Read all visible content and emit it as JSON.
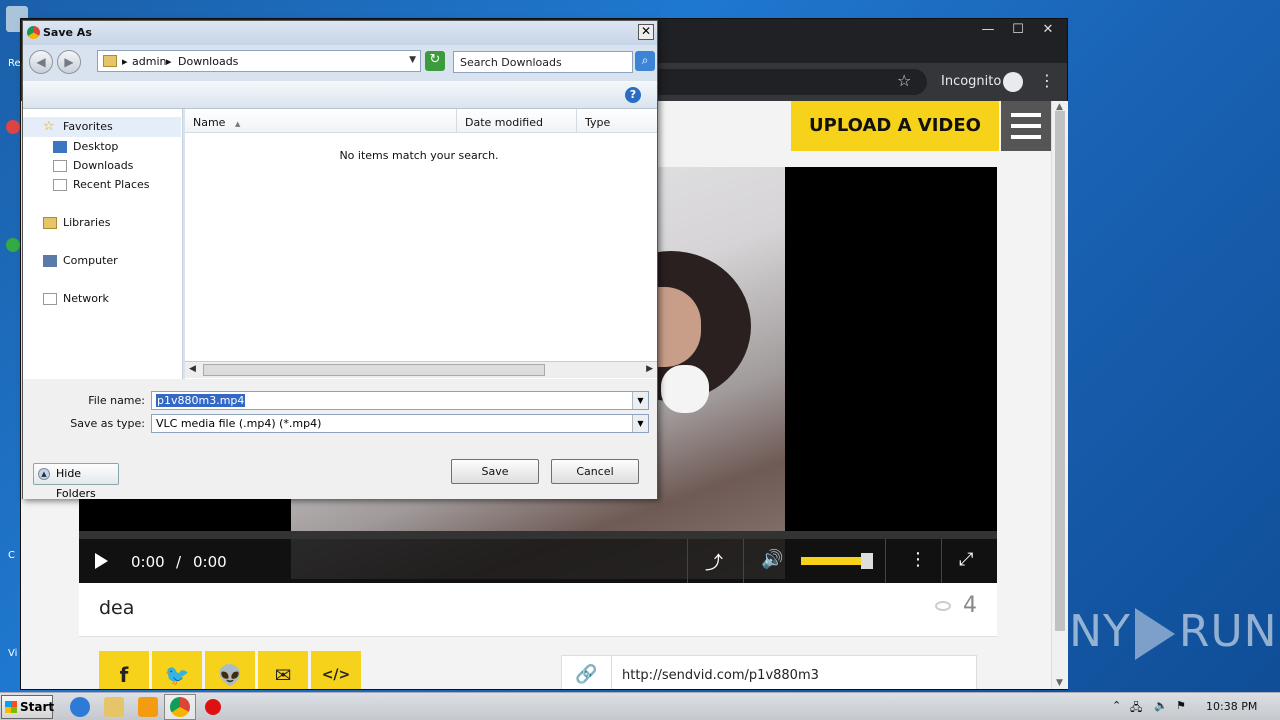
{
  "desktop": {
    "labels": [
      "Re",
      "C",
      "C",
      "Vi"
    ]
  },
  "watermark": {
    "left_text": "ANY",
    "right_text": "RUN"
  },
  "browser": {
    "window_buttons": [
      "—",
      "☐",
      "✕"
    ],
    "incognito_label": "Incognito",
    "star_icon": "☆",
    "menu_icon": "⋮",
    "page": {
      "upload_label": "UPLOAD A VIDEO",
      "player": {
        "current_time": "0:00",
        "separator": "/",
        "duration": "0:00",
        "volume_fraction": 0.85
      },
      "video_title": "dea",
      "view_count": "4",
      "share_buttons": [
        {
          "icon": "facebook-icon",
          "glyph": "f"
        },
        {
          "icon": "twitter-icon",
          "glyph": "🐦"
        },
        {
          "icon": "reddit-icon",
          "glyph": "👽"
        },
        {
          "icon": "email-icon",
          "glyph": "✉"
        },
        {
          "icon": "embed-icon",
          "glyph": "</>"
        }
      ],
      "share_link": "http://sendvid.com/p1v880m3"
    },
    "colors": {
      "accent": "#f7d21b"
    }
  },
  "dialog": {
    "title": "Save As",
    "close_label": "✕",
    "breadcrumb": [
      "admin",
      "Downloads"
    ],
    "search_placeholder": "Search Downloads",
    "nav_pane": {
      "favorites": "Favorites",
      "favorite_items": [
        "Desktop",
        "Downloads",
        "Recent Places"
      ],
      "libraries": "Libraries",
      "computer": "Computer",
      "network": "Network"
    },
    "columns": [
      "Name",
      "Date modified",
      "Type"
    ],
    "empty_message": "No items match your search.",
    "file_name_label": "File name:",
    "file_name_value": "p1v880m3.mp4",
    "save_type_label": "Save as type:",
    "save_type_value": "VLC media file (.mp4) (*.mp4)",
    "save_button": "Save",
    "cancel_button": "Cancel",
    "hide_folders_button": "Hide Folders"
  },
  "taskbar": {
    "start_label": "Start",
    "clock": "10:38 PM"
  }
}
